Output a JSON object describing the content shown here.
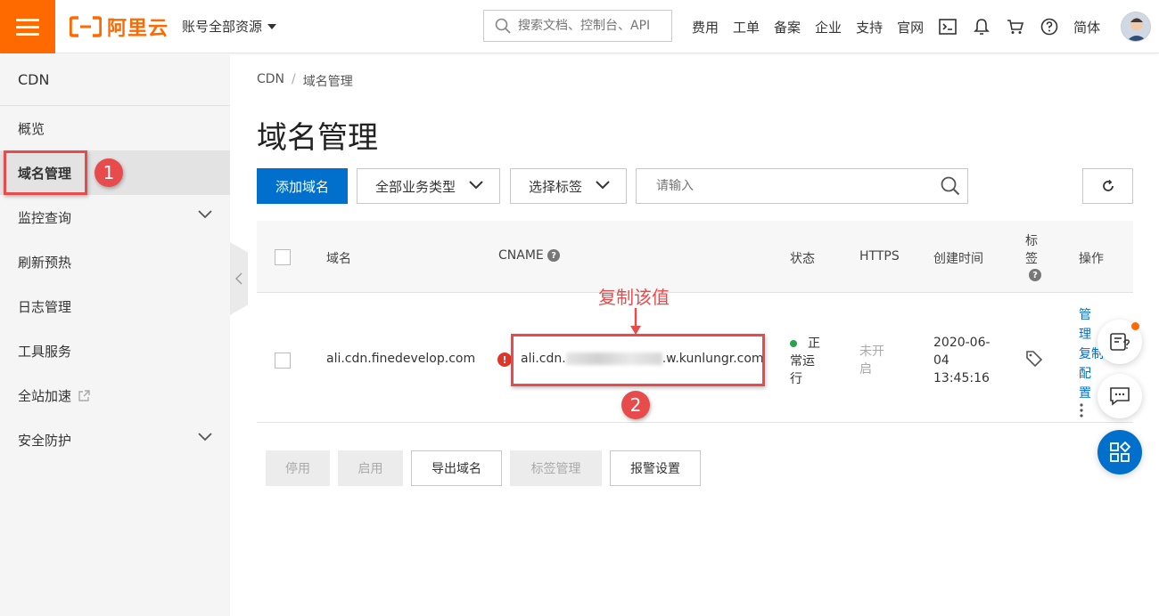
{
  "topbar": {
    "logo_text": "阿里云",
    "account_label": "账号全部资源",
    "search_placeholder": "搜索文档、控制台、API",
    "nav_links": [
      "费用",
      "工单",
      "备案",
      "企业",
      "支持",
      "官网"
    ],
    "language_label": "简体",
    "tool_icons": [
      "terminal-icon",
      "bell-icon",
      "cart-icon",
      "help-icon"
    ]
  },
  "sidebar": {
    "title": "CDN",
    "items": [
      {
        "label": "概览"
      },
      {
        "label": "域名管理",
        "active": true
      },
      {
        "label": "监控查询",
        "expandable": true
      },
      {
        "label": "刷新预热"
      },
      {
        "label": "日志管理"
      },
      {
        "label": "工具服务"
      },
      {
        "label": "全站加速",
        "external": true
      },
      {
        "label": "安全防护",
        "expandable": true
      }
    ]
  },
  "breadcrumb": [
    "CDN",
    "域名管理"
  ],
  "page_title": "域名管理",
  "toolbar": {
    "add_button": "添加域名",
    "business_type": "全部业务类型",
    "tag_select": "选择标签",
    "filter_placeholder": "请输入"
  },
  "table": {
    "headers": {
      "domain": "域名",
      "cname": "CNAME",
      "status": "状态",
      "https": "HTTPS",
      "created": "创建时间",
      "tag_1": "标",
      "tag_2": "签",
      "ops": "操作"
    },
    "rows": [
      {
        "domain": "ali.cdn.finedevelop.com",
        "cname_prefix": "ali.cdn.",
        "cname_suffix": ".w.kunlungr.com",
        "status_1": "正",
        "status_2": "常运",
        "status_3": "行",
        "https_1": "未开",
        "https_2": "启",
        "created_1": "2020-06-",
        "created_2": "04",
        "created_3": "13:45:16",
        "ops": [
          "管",
          "理",
          "复制",
          "配",
          "置"
        ]
      }
    ]
  },
  "footer_buttons": {
    "disable": "停用",
    "enable": "启用",
    "export": "导出域名",
    "tag_manage": "标签管理",
    "alert_settings": "报警设置"
  },
  "annotations": {
    "copy_label": "复制该值",
    "step_1": "1",
    "step_2": "2"
  },
  "colors": {
    "brand_orange": "#ff6a00",
    "primary_blue": "#0070cc",
    "annotation_red": "#e84b4b",
    "status_green": "#29a34a"
  }
}
